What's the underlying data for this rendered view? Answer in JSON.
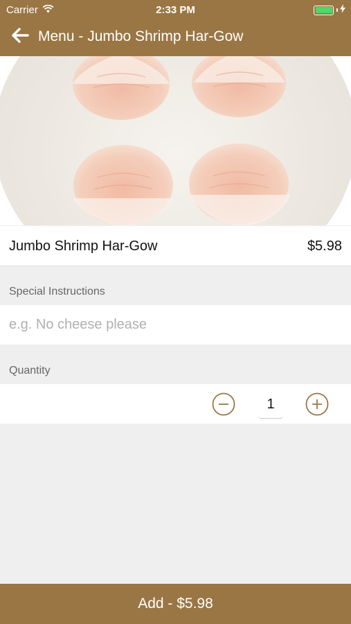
{
  "status_bar": {
    "carrier": "Carrier",
    "time": "2:33 PM"
  },
  "nav": {
    "title": "Menu - Jumbo Shrimp Har-Gow"
  },
  "item": {
    "name": "Jumbo Shrimp Har-Gow",
    "price": "$5.98"
  },
  "instructions": {
    "label": "Special Instructions",
    "placeholder": "e.g. No cheese please",
    "value": ""
  },
  "quantity": {
    "label": "Quantity",
    "value": "1"
  },
  "add_button": {
    "label": "Add - $5.98"
  },
  "colors": {
    "brand": "#9a7644",
    "battery": "#4cd964",
    "background": "#efefef"
  },
  "icons": [
    "wifi-icon",
    "battery-icon",
    "charging-icon",
    "back-arrow-icon",
    "minus-circle-icon",
    "plus-circle-icon"
  ]
}
